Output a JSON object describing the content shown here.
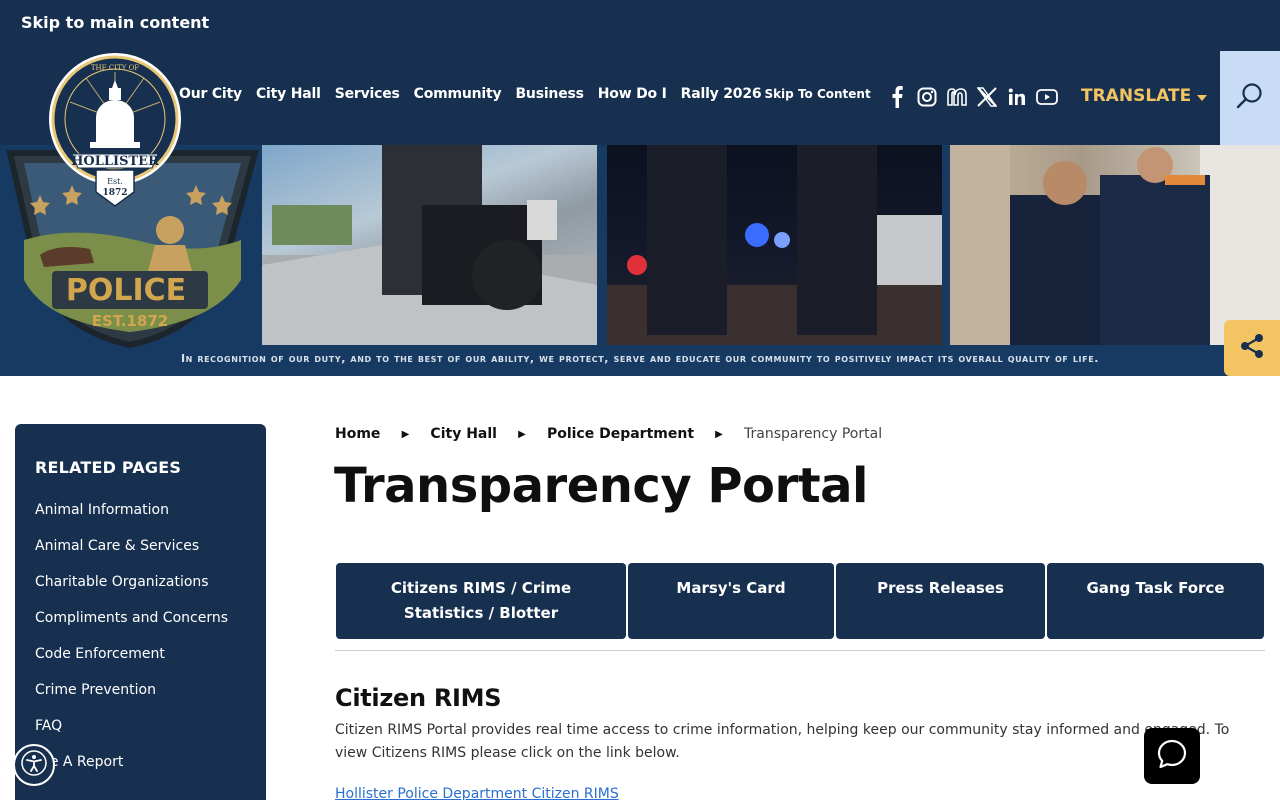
{
  "header": {
    "skip_link": "Skip to main content",
    "nav": [
      "Our City",
      "City Hall",
      "Services",
      "Community",
      "Business",
      "How Do I",
      "Rally 2026"
    ],
    "skip_content": "Skip To Content",
    "social_icons": [
      "facebook-icon",
      "instagram-icon",
      "nextdoor-icon",
      "x-icon",
      "linkedin-icon",
      "youtube-icon"
    ],
    "translate": "TRANSLATE",
    "logo": {
      "top": "THE CITY OF",
      "name": "HOLLISTER",
      "est": "Est. 1872"
    }
  },
  "hero": {
    "badge_text": "POLICE",
    "badge_est": "EST.1872",
    "tagline": "In recognition of our duty, and to the best of our ability, we protect, serve and educate our community to positively impact its overall quality of life."
  },
  "sidebar": {
    "title": "RELATED PAGES",
    "items": [
      "Animal Information",
      "Animal Care & Services",
      "Charitable Organizations",
      "Compliments and Concerns",
      "Code Enforcement",
      "Crime Prevention",
      "FAQ",
      "File A Report"
    ]
  },
  "breadcrumb": {
    "items": [
      "Home",
      "City Hall",
      "Police Department"
    ],
    "current": "Transparency Portal"
  },
  "page": {
    "title": "Transparency Portal",
    "tabs": [
      {
        "line1": "Citizens RIMS / Crime",
        "line2": "Statistics / Blotter"
      },
      {
        "line1": "Marsy's Card",
        "line2": ""
      },
      {
        "line1": "Press Releases",
        "line2": ""
      },
      {
        "line1": "Gang Task Force",
        "line2": ""
      }
    ],
    "section_title": "Citizen RIMS",
    "section_body": "Citizen RIMS Portal provides real time access to crime information, helping keep our community stay informed and engaged. To view Citizens RIMS please click on the link below.",
    "section_link": "Hollister Police Department Citizen RIMS"
  },
  "colors": {
    "navy": "#18304f",
    "gold": "#f3c462",
    "search_bg": "#c9dcf6",
    "link": "#2a6fd1"
  }
}
